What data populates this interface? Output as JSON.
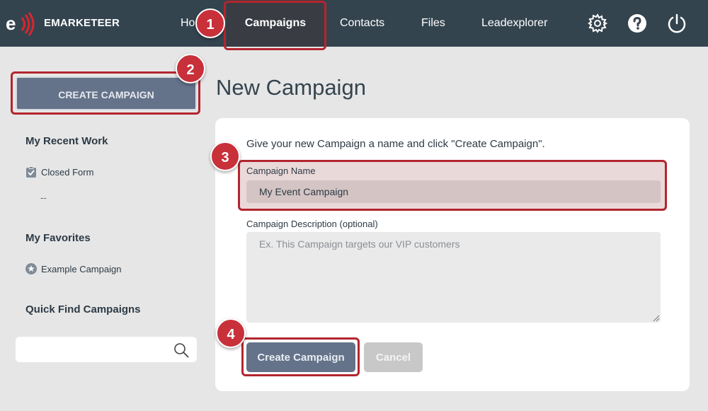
{
  "brand": {
    "name": "EMARKETEER",
    "mark": "e"
  },
  "nav": {
    "home": "Home",
    "campaigns": "Campaigns",
    "contacts": "Contacts",
    "files": "Files",
    "leadexplorer": "Leadexplorer",
    "icons": [
      "gear-icon",
      "help-icon",
      "power-icon"
    ]
  },
  "annotations": {
    "badge1": "1",
    "badge2": "2",
    "badge3": "3",
    "badge4": "4"
  },
  "sidebar": {
    "create_button": "CREATE CAMPAIGN",
    "recent_heading": "My Recent Work",
    "recent_items": [
      {
        "label": "Closed Form",
        "icon": "clipboard-check-icon"
      }
    ],
    "recent_placeholder": "--",
    "favorites_heading": "My Favorites",
    "favorite_items": [
      {
        "label": "Example Campaign",
        "icon": "star-icon"
      }
    ],
    "quick_find_heading": "Quick Find Campaigns",
    "search_value": ""
  },
  "main": {
    "title": "New Campaign",
    "instruction": "Give your new Campaign a name and click \"Create Campaign\".",
    "name_label": "Campaign Name",
    "name_value": "My Event Campaign",
    "desc_label": "Campaign Description (optional)",
    "desc_placeholder": "Ex. This Campaign targets our VIP customers",
    "create_button": "Create Campaign",
    "cancel_button": "Cancel"
  },
  "colors": {
    "topbar": "#34444f",
    "accent_button": "#64728a",
    "highlight": "#b3252e",
    "badge": "#c8303a"
  }
}
